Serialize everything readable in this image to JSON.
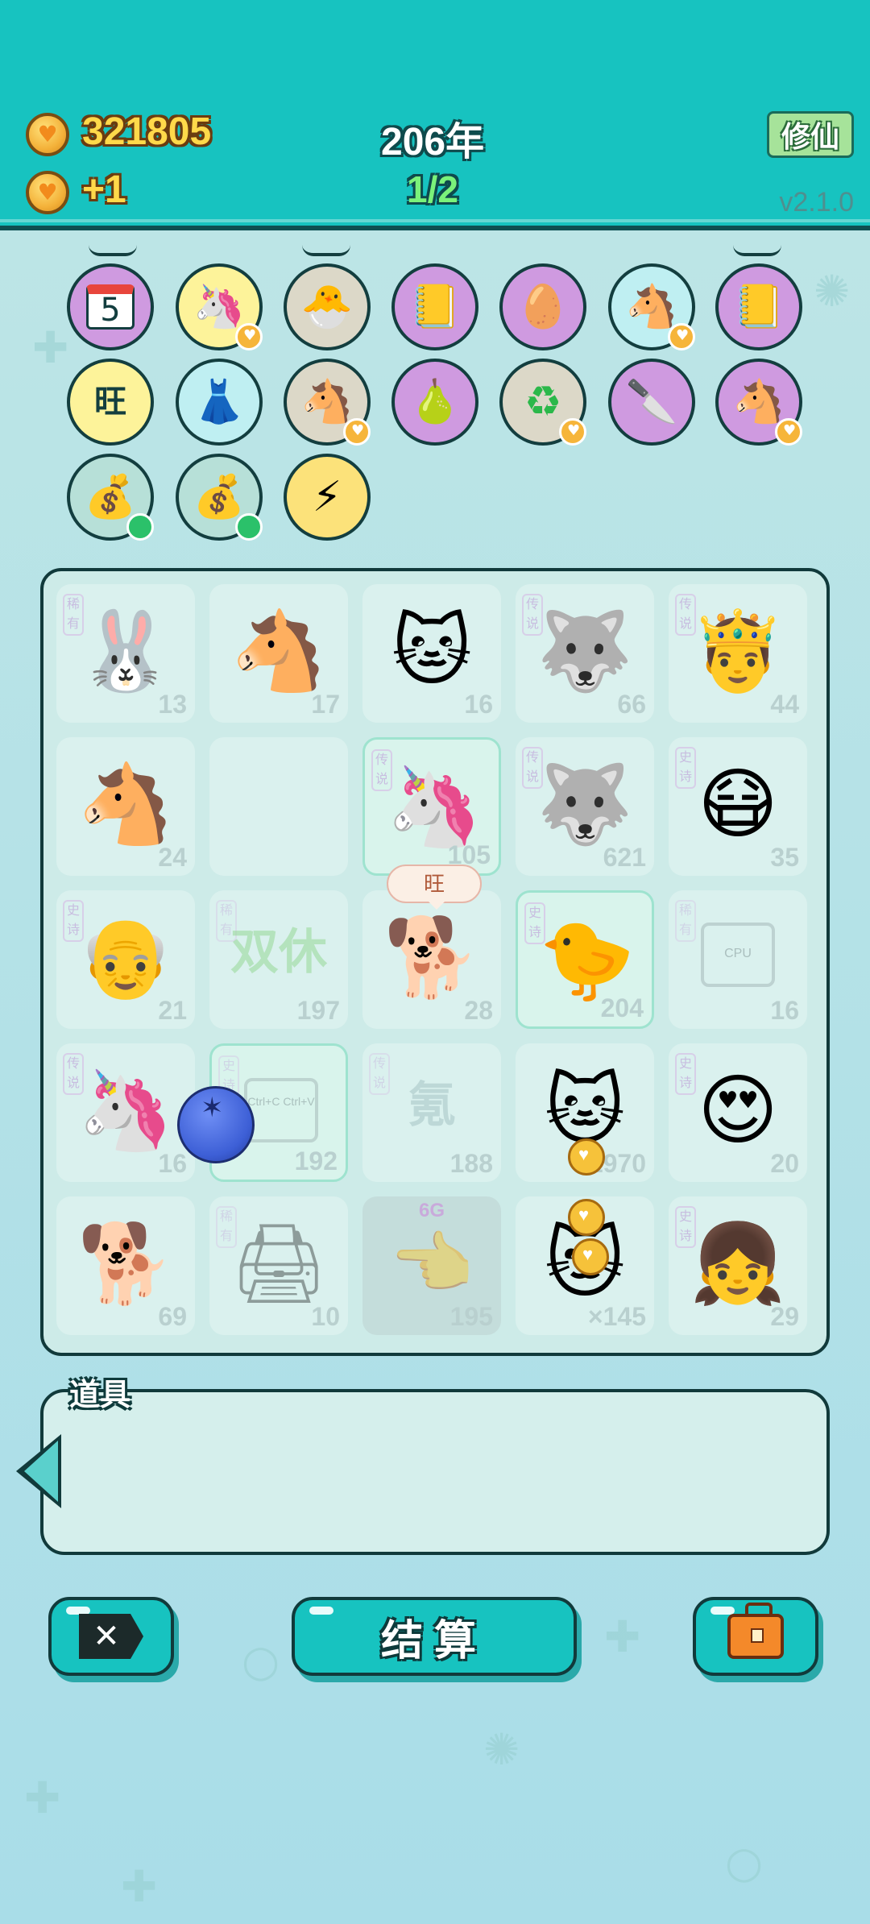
{
  "header": {
    "coins": "321805",
    "income": "+1",
    "year": "206年",
    "spins": "1/2",
    "xiuxian_label": "修仙",
    "version": "v2.1.0"
  },
  "relics": [
    {
      "icon": "calendar-icon",
      "glyph": "5",
      "color": "purple"
    },
    {
      "icon": "unicorn-icon",
      "glyph": "🦄",
      "color": "yellow",
      "badge": "heart"
    },
    {
      "icon": "chick-egg-icon",
      "glyph": "🐣",
      "color": "grey"
    },
    {
      "icon": "sticky-note-icon",
      "glyph": "📒",
      "color": "purple"
    },
    {
      "icon": "egg-icon",
      "glyph": "🥚",
      "color": "purple"
    },
    {
      "icon": "twin-horses-icon",
      "glyph": "🐴",
      "color": "cyan",
      "badge": "heart"
    },
    {
      "icon": "sticky-note-icon",
      "glyph": "📒",
      "color": "purple"
    },
    {
      "icon": "wang-characters-icon",
      "glyph": "旺",
      "color": "yellow"
    },
    {
      "icon": "skirt-icon",
      "glyph": "👗",
      "color": "cyan"
    },
    {
      "icon": "twin-horses-icon",
      "glyph": "🐴",
      "color": "grey",
      "badge": "heart"
    },
    {
      "icon": "guava-icon",
      "glyph": "🍐",
      "color": "purple"
    },
    {
      "icon": "refresh-icon",
      "glyph": "♻",
      "color": "grey",
      "badge": "heart"
    },
    {
      "icon": "cleaver-icon",
      "glyph": "🔪",
      "color": "purple"
    },
    {
      "icon": "twin-horses-icon",
      "glyph": "🐴",
      "color": "purple",
      "badge": "heart"
    },
    {
      "icon": "sack-icon",
      "glyph": "💰",
      "color": "teal",
      "badge": "green"
    },
    {
      "icon": "sack-icon",
      "glyph": "💰",
      "color": "teal",
      "badge": "green"
    },
    {
      "icon": "lightning-icon",
      "glyph": "⚡",
      "color": "gold"
    }
  ],
  "board": [
    {
      "name": "rabbit",
      "glyph": "🐰",
      "count": "13",
      "tag": "稀有"
    },
    {
      "name": "horse",
      "glyph": "🐴",
      "count": "17",
      "tag": ""
    },
    {
      "name": "cat",
      "glyph": "🐱",
      "count": "16",
      "tag": ""
    },
    {
      "name": "husky-king",
      "glyph": "🐺",
      "count": "66",
      "tag": "传说"
    },
    {
      "name": "crowned-man",
      "glyph": "🤴",
      "count": "44",
      "tag": "传说"
    },
    {
      "name": "horse",
      "glyph": "🐴",
      "count": "24",
      "tag": ""
    },
    {
      "name": "empty",
      "glyph": "",
      "count": "",
      "tag": ""
    },
    {
      "name": "unicorn",
      "glyph": "🦄",
      "count": "105",
      "tag": "传说"
    },
    {
      "name": "husky-king",
      "glyph": "🐺",
      "count": "621",
      "tag": "传说"
    },
    {
      "name": "masked-man",
      "glyph": "😷",
      "count": "35",
      "tag": "史诗"
    },
    {
      "name": "old-man",
      "glyph": "👴",
      "count": "21",
      "tag": "史诗"
    },
    {
      "name": "double-rest",
      "glyph": "双休",
      "count": "197",
      "tag": "稀有"
    },
    {
      "name": "dog",
      "glyph": "🐕",
      "count": "28",
      "tag": ""
    },
    {
      "name": "chick-grandpa",
      "glyph": "🐤",
      "count": "204",
      "tag": "史诗"
    },
    {
      "name": "cpu",
      "glyph": "CPU",
      "count": "16",
      "tag": "稀有"
    },
    {
      "name": "unicorn",
      "glyph": "🦄",
      "count": "16",
      "tag": "传说"
    },
    {
      "name": "copy-paste",
      "glyph": "Ctrl+C Ctrl+V",
      "count": "192",
      "tag": "史诗"
    },
    {
      "name": "krypton",
      "glyph": "氪",
      "count": "188",
      "tag": "传说"
    },
    {
      "name": "cat",
      "glyph": "🐱",
      "count": "1970",
      "tag": ""
    },
    {
      "name": "love-man",
      "glyph": "😍",
      "count": "20",
      "tag": "史诗"
    },
    {
      "name": "dog",
      "glyph": "🐕",
      "count": "69",
      "tag": ""
    },
    {
      "name": "printer",
      "glyph": "🖨",
      "count": "10",
      "tag": "稀有"
    },
    {
      "name": "finger",
      "glyph": "👈",
      "count": "195",
      "tag": "",
      "overlay": "6G"
    },
    {
      "name": "cat",
      "glyph": "🐱",
      "count": "×145",
      "tag": ""
    },
    {
      "name": "girl",
      "glyph": "👧",
      "count": "29",
      "tag": "史诗"
    }
  ],
  "bubble": "旺",
  "items": {
    "label": "道具"
  },
  "buttons": {
    "settle": "结算"
  }
}
